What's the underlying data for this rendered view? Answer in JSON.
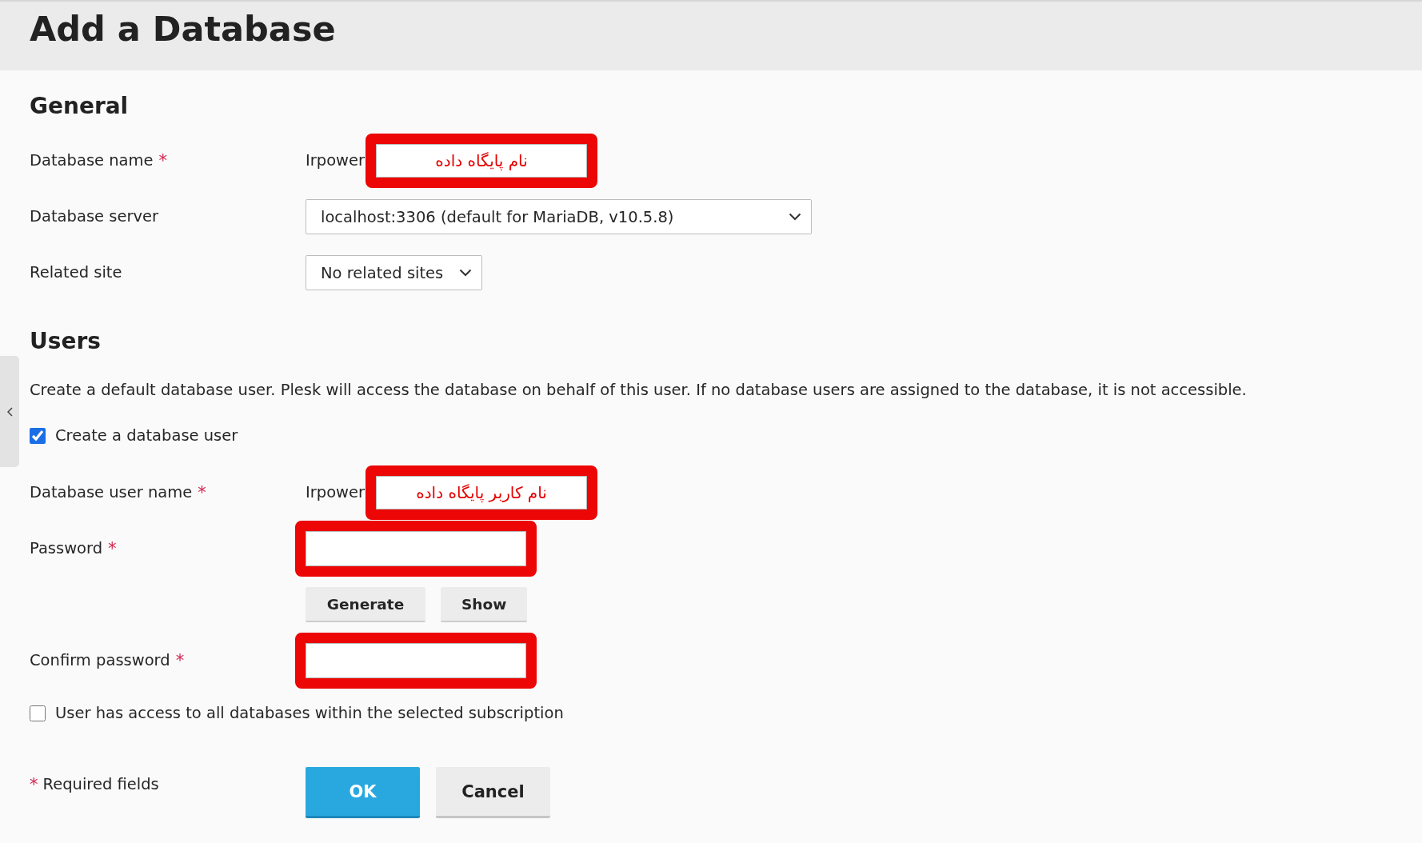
{
  "page": {
    "title": "Add a Database"
  },
  "sections": [
    {
      "title": "General",
      "rows": [
        {
          "kind": "text",
          "label": "Database name",
          "required_mark": "*",
          "prefix": "Irpower",
          "value": "نام پایگاه داده",
          "highlighted": true
        },
        {
          "kind": "select",
          "label": "Database server",
          "value": "localhost:3306 (default for MariaDB, v10.5.8)",
          "highlighted": false
        },
        {
          "kind": "select",
          "label": "Related site",
          "value": "No related sites",
          "highlighted": false
        }
      ]
    },
    {
      "title": "Users",
      "rows": [
        {
          "kind": "paragraph",
          "text": "Create a default database user. Plesk will access the database on behalf of this user. If no database users are assigned to the database, it is not accessible."
        },
        {
          "kind": "checkbox",
          "label": "Create a database user",
          "checked": true
        },
        {
          "kind": "text",
          "label": "Database user name",
          "required_mark": "*",
          "prefix": "Irpower",
          "value": "نام کاربر پایگاه داده",
          "highlighted": true
        },
        {
          "kind": "password",
          "label": "Password",
          "required_mark": "*",
          "highlighted": true
        },
        {
          "kind": "buttons",
          "buttons": [
            {
              "label": "Generate"
            },
            {
              "label": "Show"
            }
          ]
        },
        {
          "kind": "password",
          "label": "Confirm password",
          "required_mark": "*",
          "highlighted": true
        },
        {
          "kind": "checkbox",
          "label": "User has access to all databases within the selected subscription",
          "checked": false
        }
      ]
    }
  ],
  "footer": {
    "required_note": {
      "mark": "*",
      "text": "Required fields"
    },
    "buttons": [
      {
        "label": "OK",
        "primary": true
      },
      {
        "label": "Cancel",
        "primary": false
      }
    ]
  }
}
